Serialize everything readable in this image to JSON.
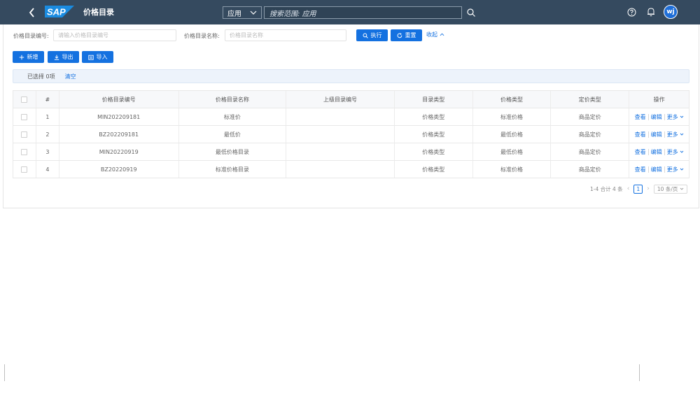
{
  "header": {
    "brand": "SAP",
    "title": "价格目录",
    "scope": "应用",
    "search_placeholder": "搜索范围: 应用",
    "user_initials": "wj"
  },
  "filters": {
    "code_label": "价格目录编号:",
    "code_placeholder": "请输入价格目录编号",
    "name_label": "价格目录名称:",
    "name_placeholder": "价格目录名称",
    "execute_label": "执行",
    "reset_label": "重置",
    "collapse_label": "收起"
  },
  "toolbar": {
    "add_label": "新增",
    "export_label": "导出",
    "import_label": "导入"
  },
  "selection": {
    "count_text": "已选择 0项",
    "clear_label": "清空"
  },
  "table": {
    "columns": [
      "#",
      "价格目录编号",
      "价格目录名称",
      "上级目录编号",
      "目录类型",
      "价格类型",
      "定价类型",
      "操作"
    ],
    "rows": [
      {
        "index": "1",
        "code": "MIN202209181",
        "name": "标准价",
        "parent": "",
        "catalog_type": "价格类型",
        "price_type": "标准价格",
        "pricing_type": "商品定价"
      },
      {
        "index": "2",
        "code": "BZ202209181",
        "name": "最低价",
        "parent": "",
        "catalog_type": "价格类型",
        "price_type": "最低价格",
        "pricing_type": "商品定价"
      },
      {
        "index": "3",
        "code": "MIN20220919",
        "name": "最低价格目录",
        "parent": "",
        "catalog_type": "价格类型",
        "price_type": "最低价格",
        "pricing_type": "商品定价"
      },
      {
        "index": "4",
        "code": "BZ20220919",
        "name": "标准价格目录",
        "parent": "",
        "catalog_type": "价格类型",
        "price_type": "标准价格",
        "pricing_type": "商品定价"
      }
    ],
    "actions": {
      "view": "查看",
      "edit": "编辑",
      "more": "更多"
    }
  },
  "pagination": {
    "summary": "1-4 合计 4 条",
    "current_page": "1",
    "page_size": "10 条/页"
  },
  "colors": {
    "header_bg": "#354a5f",
    "primary": "#1471e0",
    "sap_blue": "#0a6ed1"
  }
}
